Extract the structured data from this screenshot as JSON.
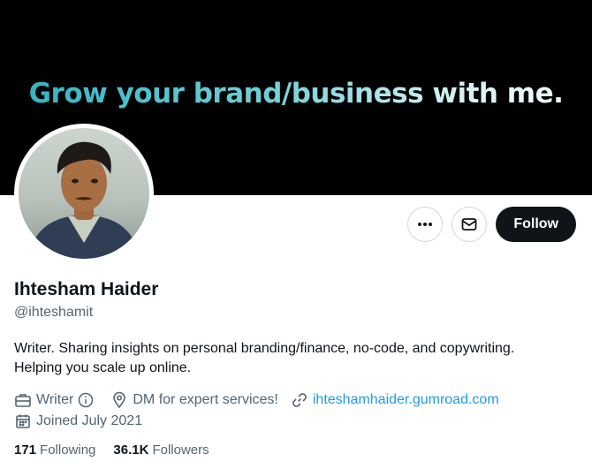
{
  "banner": {
    "text": "Grow your brand/business with me."
  },
  "actions": {
    "more_icon": "more-horizontal-icon",
    "message_icon": "envelope-icon",
    "follow_label": "Follow"
  },
  "profile": {
    "name": "Ihtesham Haider",
    "handle": "@ihteshamit",
    "bio_line1": "Writer. Sharing insights on personal branding/finance, no-code, and copywriting.",
    "bio_line2": "Helping you scale up online.",
    "category": "Writer",
    "location": "DM for expert services!",
    "website": "ihteshamhaider.gumroad.com",
    "joined": "Joined July 2021"
  },
  "stats": {
    "following_count": "171",
    "following_label": "Following",
    "followers_count": "36.1K",
    "followers_label": "Followers"
  },
  "colors": {
    "link": "#1d9bf0",
    "banner_bg": "#000000",
    "banner_accent": "#2bb3c0",
    "follow_bg": "#0f1419"
  }
}
